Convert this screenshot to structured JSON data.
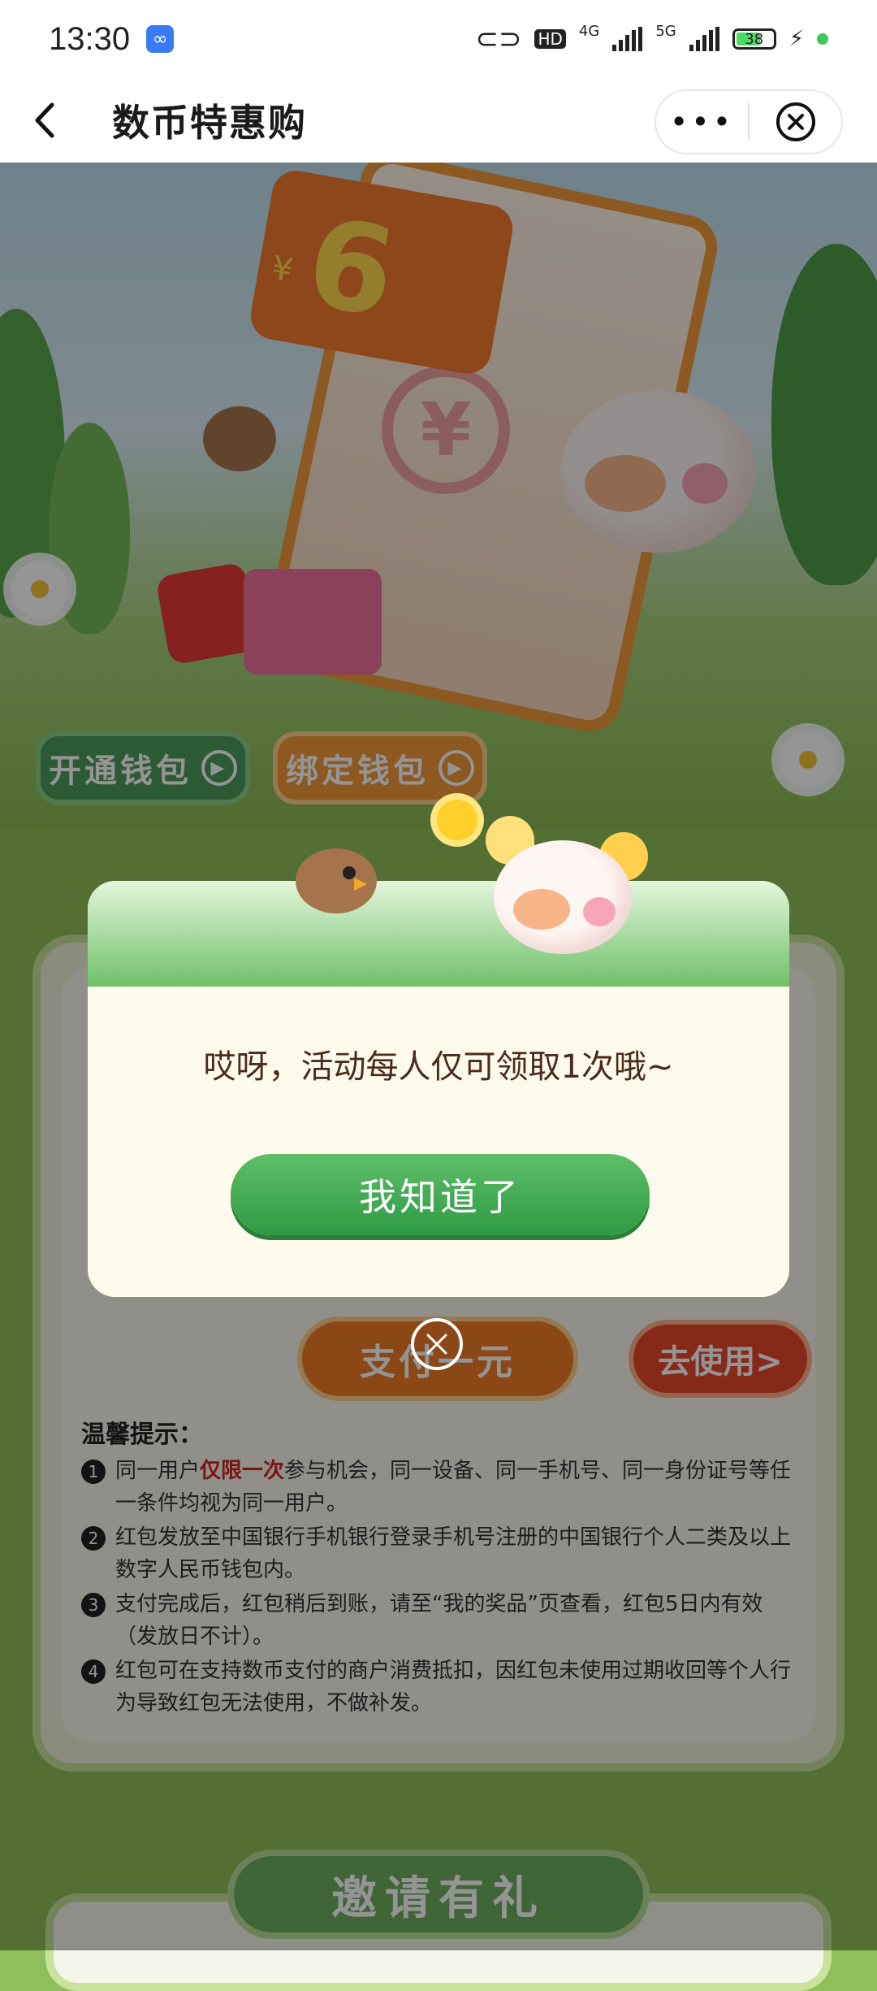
{
  "status_bar": {
    "time": "13:30",
    "network_hd": "HD",
    "net_4g": "4G",
    "net_5g": "5G",
    "battery": "38"
  },
  "nav": {
    "title": "数币特惠购",
    "more_label": "•••"
  },
  "hero": {
    "card_amount": "6",
    "card_currency": "¥",
    "rmb_symbol": "¥",
    "btn_open_wallet": "开通钱包",
    "btn_bind_wallet": "绑定钱包"
  },
  "dialog": {
    "message": "哎呀，活动每人仅可领取1次哦~",
    "confirm_label": "我知道了"
  },
  "panel": {
    "pay_label": "支付一元",
    "use_label": "去使用>"
  },
  "tips": {
    "title": "温馨提示：",
    "items": [
      {
        "num": "1",
        "pre": "同一用户",
        "em": "仅限一次",
        "post": "参与机会，同一设备、同一手机号、同一身份证号等任一条件均视为同一用户。"
      },
      {
        "num": "2",
        "text": "红包发放至中国银行手机银行登录手机号注册的中国银行个人二类及以上数字人民币钱包内。"
      },
      {
        "num": "3",
        "text": "支付完成后，红包稍后到账，请至“我的奖品”页查看，红包5日内有效（发放日不计）。"
      },
      {
        "num": "4",
        "text": "红包可在支持数币支付的商户消费抵扣，因红包未使用过期收回等个人行为导致红包无法使用，不做补发。"
      }
    ]
  },
  "invite": {
    "title": "邀请有礼"
  },
  "colors": {
    "brand_green": "#2f9a45",
    "accent_orange": "#f07b25",
    "emphasis_red": "#d62424",
    "page_green": "#8fbf5a"
  }
}
